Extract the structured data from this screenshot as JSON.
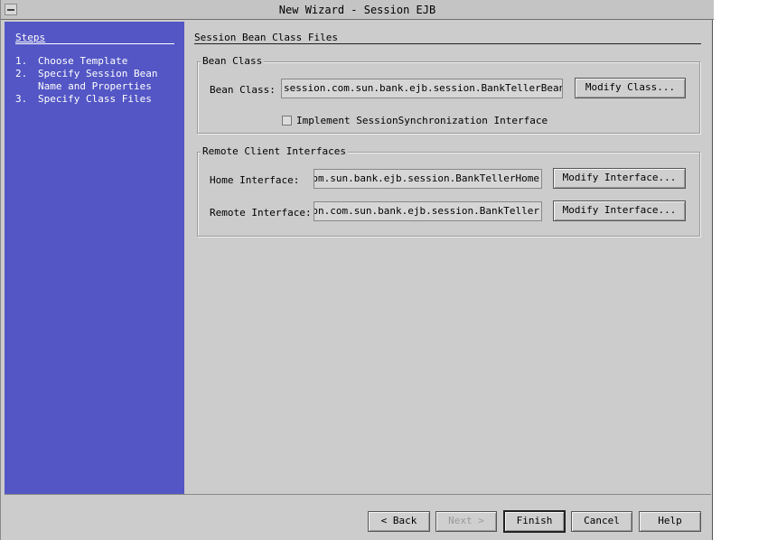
{
  "window": {
    "title": "New Wizard - Session EJB"
  },
  "steps": {
    "title": "Steps",
    "items": [
      {
        "num": "1.",
        "lines": [
          "Choose Template"
        ]
      },
      {
        "num": "2.",
        "lines": [
          "Specify Session Bean",
          "Name and Properties"
        ]
      },
      {
        "num": "3.",
        "lines": [
          "Specify Class Files"
        ]
      }
    ]
  },
  "page": {
    "title": "Session Bean Class Files"
  },
  "bean_class": {
    "group_label": "Bean Class",
    "label": "Bean Class:",
    "value": "session.com.sun.bank.ejb.session.BankTellerBean",
    "modify_button": "Modify Class...",
    "checkbox_label": "Implement SessionSynchronization Interface",
    "checkbox_checked": false
  },
  "remote": {
    "group_label": "Remote Client Interfaces",
    "home_label": "Home Interface:",
    "home_value": "session.com.sun.bank.ejb.session.BankTellerHome",
    "remote_label": "Remote Interface:",
    "remote_value": "session.com.sun.bank.ejb.session.BankTeller",
    "modify_button": "Modify Interface..."
  },
  "buttons": {
    "back": "< Back",
    "next": "Next >",
    "finish": "Finish",
    "cancel": "Cancel",
    "help": "Help"
  }
}
